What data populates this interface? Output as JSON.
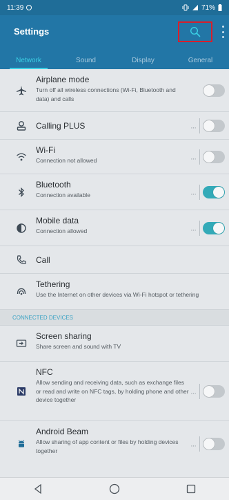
{
  "status_bar": {
    "time": "11:39",
    "battery": "71%"
  },
  "header": {
    "title": "Settings"
  },
  "tabs": [
    {
      "label": "Network",
      "active": true
    },
    {
      "label": "Sound",
      "active": false
    },
    {
      "label": "Display",
      "active": false
    },
    {
      "label": "General",
      "active": false
    }
  ],
  "settings": [
    {
      "icon": "airplane-icon",
      "label": "Airplane mode",
      "sub": "Turn off all wireless connections (Wi-Fi, Bluetooth and data) and calls",
      "toggle": "off"
    },
    {
      "icon": "calling-plus-icon",
      "label": "Calling PLUS",
      "sub": "",
      "toggle": "off",
      "more": "···"
    },
    {
      "icon": "wifi-icon",
      "label": "Wi-Fi",
      "sub": "Connection not allowed",
      "toggle": "off",
      "more": "···"
    },
    {
      "icon": "bluetooth-icon",
      "label": "Bluetooth",
      "sub": "Connection available",
      "toggle": "on",
      "more": "···"
    },
    {
      "icon": "mobile-data-icon",
      "label": "Mobile data",
      "sub": "Connection allowed",
      "toggle": "on",
      "more": "···"
    },
    {
      "icon": "call-icon",
      "label": "Call",
      "sub": ""
    },
    {
      "icon": "tethering-icon",
      "label": "Tethering",
      "sub": "Use the Internet on other devices via Wi-Fi hotspot or tethering"
    }
  ],
  "section": {
    "connected_devices": "CONNECTED DEVICES"
  },
  "connected": [
    {
      "icon": "screen-sharing-icon",
      "label": "Screen sharing",
      "sub": "Share screen and sound with TV"
    },
    {
      "icon": "nfc-icon",
      "label": "NFC",
      "sub": "Allow sending and receiving data, such as exchange files or read and write on NFC tags, by holding phone and other device together",
      "toggle": "off",
      "more": "···"
    },
    {
      "icon": "android-beam-icon",
      "label": "Android Beam",
      "sub": "Allow sharing of app content or files by holding devices together",
      "toggle": "off",
      "more": "···"
    }
  ],
  "colors": {
    "header": "#2276a6",
    "status_bar": "#1f6d98",
    "accent": "#3bd0e5",
    "toggle_on": "#33aab8",
    "highlight_box": "#d81e2b"
  }
}
